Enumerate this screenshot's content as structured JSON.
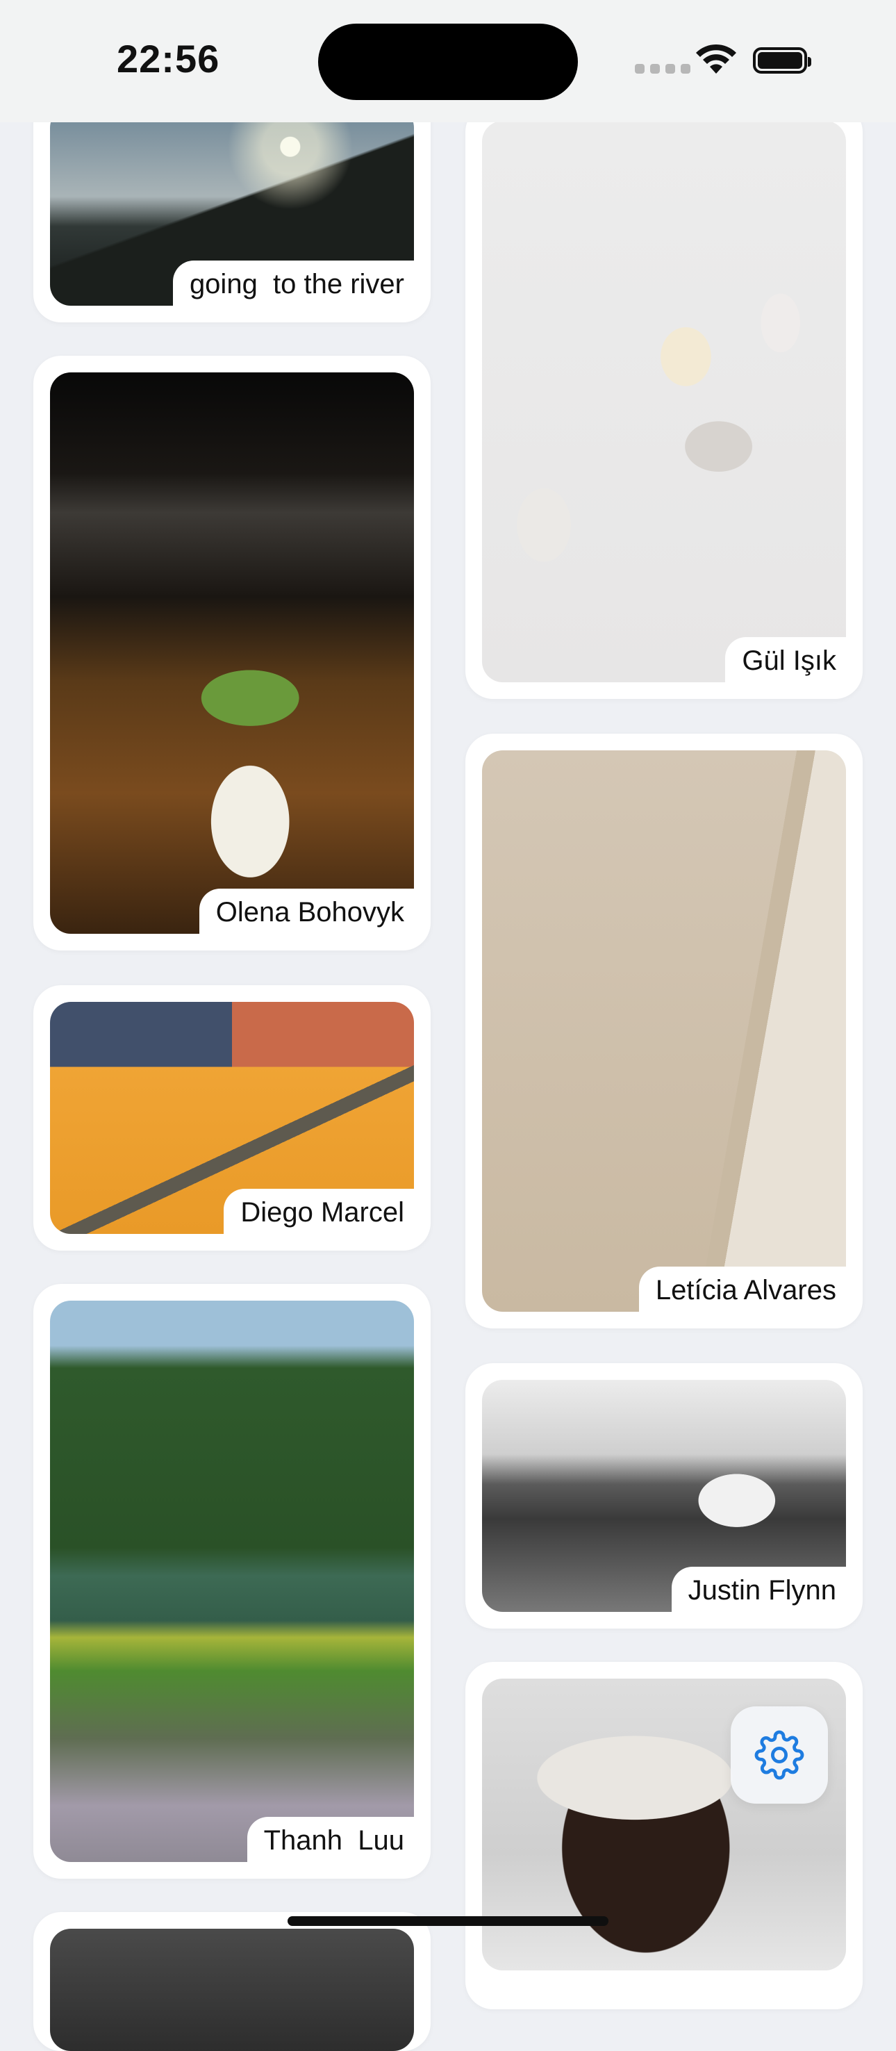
{
  "status_bar": {
    "time": "22:56"
  },
  "feed": {
    "left_column": [
      {
        "caption": "going  to the river",
        "photo": "mountain-sunset"
      },
      {
        "caption": "Olena Bohovyk",
        "photo": "matcha-drink"
      },
      {
        "caption": "Diego Marcel",
        "photo": "yellow-stairs"
      },
      {
        "caption": "Thanh  Luu",
        "photo": "river-valley"
      }
    ],
    "right_column": [
      {
        "caption": "Gül Işık",
        "photo": "plaster-statues"
      },
      {
        "caption": "Letícia Alvares",
        "photo": "wall-shadow"
      },
      {
        "caption": "Justin Flynn",
        "photo": "white-horse"
      },
      {
        "caption": "",
        "photo": "man-headphones"
      }
    ]
  },
  "settings_button": {
    "icon": "gear-icon",
    "color": "#1e7ce0"
  }
}
